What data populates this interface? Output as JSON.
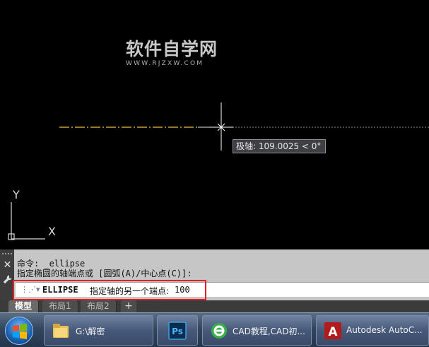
{
  "canvas": {
    "watermark_title": "软件自学网",
    "watermark_url": "WWW.RJZXW.COM",
    "tooltip": "极轴: 109.0025 < 0°",
    "ucs_y_label": "Y",
    "ucs_x_label": "X"
  },
  "command": {
    "history_line1": "命令: _ellipse",
    "history_line2": "指定椭圆的轴端点或 [圆弧(A)/中心点(C)]:",
    "prompt_icon": "⋮⋰▾",
    "prompt_name": "ELLIPSE",
    "prompt_text": "指定轴的另一个端点:",
    "input_value": "100",
    "close_symbol": "✕"
  },
  "layout_tabs": [
    {
      "label": "模型",
      "active": true
    },
    {
      "label": "布局1",
      "active": false
    },
    {
      "label": "布局2",
      "active": false
    }
  ],
  "tab_add_label": "+",
  "taskbar": {
    "items": [
      {
        "label": "G:\\解密",
        "icon": "folder-icon"
      },
      {
        "label": "",
        "icon": "photoshop-icon",
        "icon_text": "Ps"
      },
      {
        "label": "CAD教程,CAD初...",
        "icon": "browser-icon"
      },
      {
        "label": "Autodesk AutoC...",
        "icon": "autocad-icon",
        "icon_text": "A"
      }
    ]
  },
  "colors": {
    "canvas_bg": "#000000",
    "dashed_line": "#c8a040",
    "command_bg": "#c6c6c6",
    "highlight": "#e02020",
    "taskbar": "#33465e"
  }
}
